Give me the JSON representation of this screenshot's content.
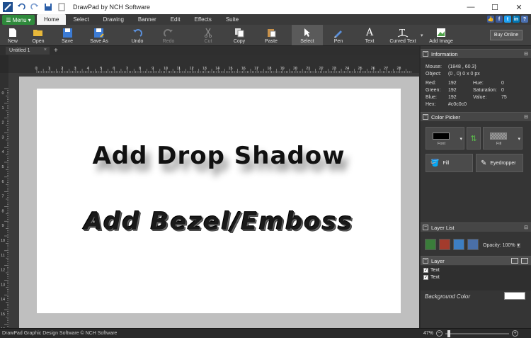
{
  "window": {
    "title": "DrawPad by NCH Software",
    "minimize": "—",
    "maximize": "☐",
    "close": "✕"
  },
  "menu": {
    "menu_label": "Menu",
    "tabs": [
      "Home",
      "Select",
      "Drawing",
      "Banner",
      "Edit",
      "Effects",
      "Suite"
    ],
    "active_tab": "Home"
  },
  "toolbar": {
    "tools": [
      {
        "label": "New",
        "icon": "new-icon"
      },
      {
        "label": "Open",
        "icon": "open-icon"
      },
      {
        "label": "Save",
        "icon": "save-icon"
      },
      {
        "label": "Save As",
        "icon": "save-as-icon"
      },
      {
        "label": "Undo",
        "icon": "undo-icon"
      },
      {
        "label": "Redo",
        "icon": "redo-icon",
        "disabled": true
      },
      {
        "label": "Cut",
        "icon": "cut-icon",
        "disabled": true
      },
      {
        "label": "Copy",
        "icon": "copy-icon"
      },
      {
        "label": "Paste",
        "icon": "paste-icon"
      },
      {
        "label": "Select",
        "icon": "select-icon",
        "pressed": true
      },
      {
        "label": "Pen",
        "icon": "pen-icon"
      },
      {
        "label": "Text",
        "icon": "text-icon"
      },
      {
        "label": "Curved Text",
        "icon": "curved-text-icon"
      },
      {
        "label": "Add Image",
        "icon": "add-image-icon"
      }
    ],
    "buy_online": "Buy Online"
  },
  "document": {
    "tab_name": "Untitled 1",
    "close_glyph": "×",
    "add_tab": "+"
  },
  "rulers": {
    "horizontal": [
      "0",
      "1",
      "2",
      "3",
      "4",
      "5",
      "6",
      "7",
      "8",
      "9",
      "10",
      "11",
      "12",
      "13",
      "14",
      "15",
      "16",
      "17",
      "18",
      "19",
      "20",
      "21",
      "22",
      "23",
      "24",
      "25",
      "26",
      "27",
      "28"
    ],
    "vertical": [
      "0",
      "1",
      "2",
      "3",
      "4",
      "5",
      "6",
      "7",
      "8",
      "9",
      "10",
      "11",
      "12",
      "13",
      "14",
      "15",
      "16"
    ]
  },
  "canvas": {
    "text_shadow": "Add Drop Shadow",
    "text_bezel": "Add Bezel/Emboss"
  },
  "status": {
    "text": "DrawPad Graphic Design Software © NCH Software",
    "zoom": "47%",
    "zoom_fraction": 0.03
  },
  "information": {
    "title": "Information",
    "mouse_label": "Mouse:",
    "mouse_value": "(1848 , 60.3)",
    "object_label": "Object:",
    "object_value": "(0 , 0) 0 x 0 px",
    "red_label": "Red:",
    "red_value": "192",
    "green_label": "Green:",
    "green_value": "192",
    "blue_label": "Blue:",
    "blue_value": "192",
    "hex_label": "Hex:",
    "hex_value": "#c0c0c0",
    "hue_label": "Hue:",
    "hue_value": "0",
    "sat_label": "Saturation:",
    "sat_value": "0",
    "val_label": "Value:",
    "val_value": "75"
  },
  "color_picker": {
    "title": "Color Picker",
    "font_label": "Font",
    "fill_label": "Fill",
    "fill_button": "Fill",
    "eyedropper_button": "Eyedropper",
    "font_color": "#000000"
  },
  "layer_list": {
    "title": "Layer List",
    "opacity_label": "Opacity:",
    "opacity_value": "100%",
    "layer_title": "Layer",
    "items": [
      "Text",
      "Text"
    ],
    "background_label": "Background Color",
    "background_color": "#ffffff"
  },
  "colors": {
    "accent_green": "#2f8a3c",
    "panel": "#353535",
    "canvas_surround": "#bfbfbf"
  }
}
